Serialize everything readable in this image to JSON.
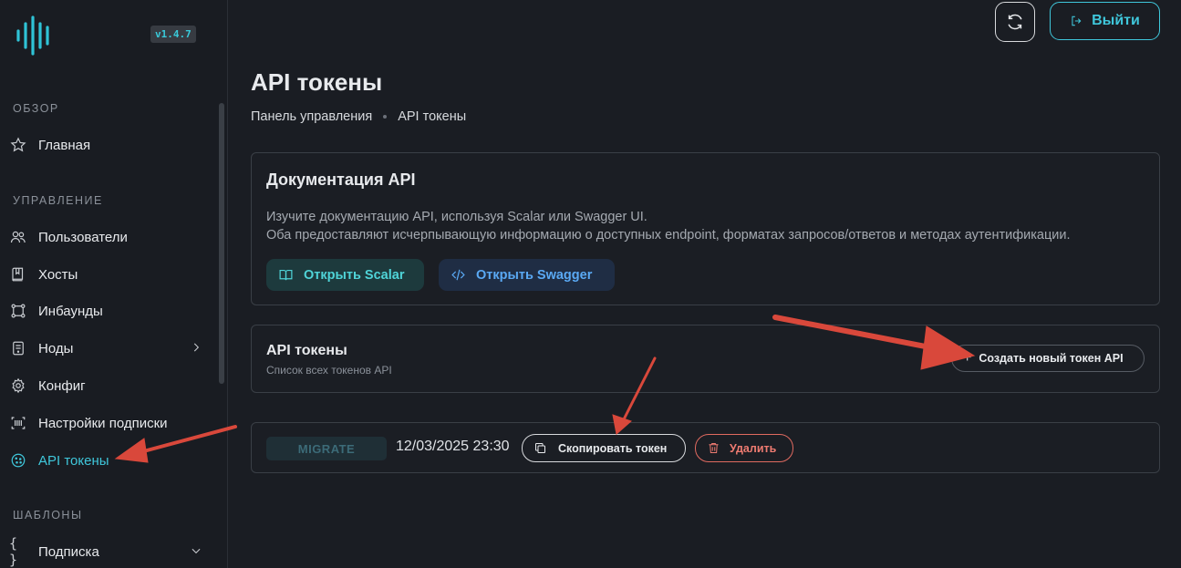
{
  "sidebar": {
    "version": "v1.4.7",
    "sections": [
      {
        "label": "ОБЗОР"
      },
      {
        "label": "УПРАВЛЕНИЕ"
      },
      {
        "label": "ШАБЛОНЫ"
      }
    ],
    "items": [
      {
        "label": "Главная",
        "icon": "star-icon"
      },
      {
        "label": "Пользователи",
        "icon": "users-icon"
      },
      {
        "label": "Хосты",
        "icon": "book-icon"
      },
      {
        "label": "Инбаунды",
        "icon": "network-icon"
      },
      {
        "label": "Ноды",
        "icon": "server-icon"
      },
      {
        "label": "Конфиг",
        "icon": "gear-icon"
      },
      {
        "label": "Настройки подписки",
        "icon": "barcode-icon"
      },
      {
        "label": "API токены",
        "icon": "cookie-icon",
        "active": true
      },
      {
        "label": "Подписка",
        "icon": "braces-icon"
      }
    ]
  },
  "header": {
    "logout_label": "Выйти"
  },
  "main": {
    "title": "API токены",
    "breadcrumb": [
      "Панель управления",
      "API токены"
    ]
  },
  "docs_card": {
    "title": "Документация API",
    "line1": "Изучите документацию API, используя Scalar или Swagger UI.",
    "line2": "Оба предоставляют исчерпывающую информацию о доступных endpoint, форматах запросов/ответов и методах аутентификации.",
    "scalar_label": "Открыть Scalar",
    "swagger_label": "Открыть Swagger"
  },
  "tokens_card": {
    "title": "API токены",
    "subtitle": "Список всех токенов API",
    "create_label": "Создать новый токен API"
  },
  "tokens": [
    {
      "name": "MIGRATE",
      "date": "12/03/2025 23:30",
      "copy_label": "Скопировать токен",
      "delete_label": "Удалить"
    }
  ],
  "colors": {
    "accent": "#3fc7db",
    "danger": "#ee7b71",
    "annotation_arrow": "#d9483b"
  }
}
